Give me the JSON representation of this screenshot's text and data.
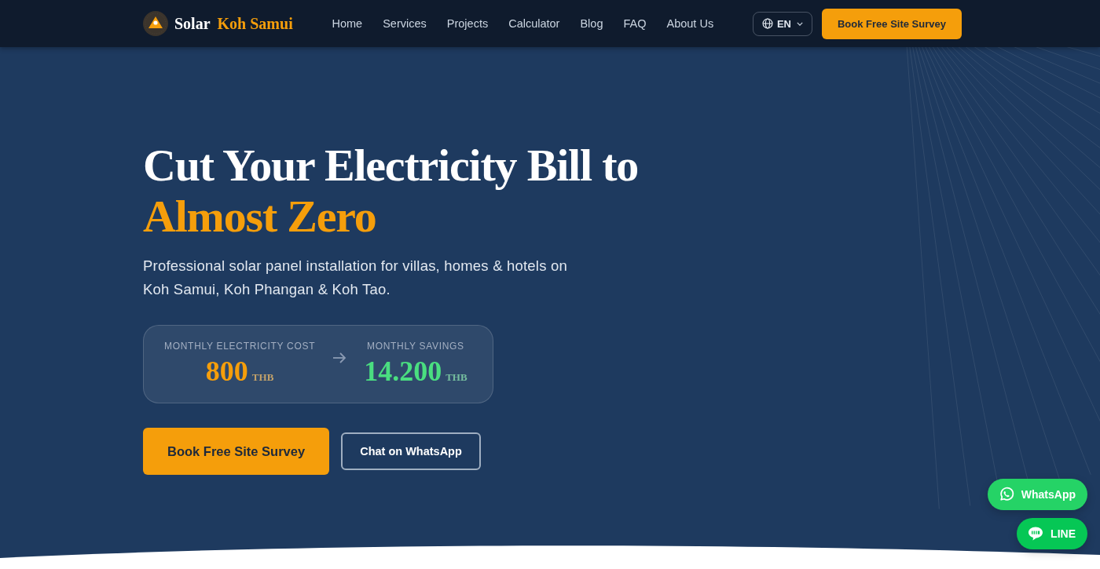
{
  "nav": {
    "brand": {
      "name": "Solar",
      "highlight": "Koh Samui"
    },
    "links": [
      "Home",
      "Services",
      "Projects",
      "Calculator",
      "Blog",
      "FAQ",
      "About Us"
    ],
    "language": "EN",
    "cta": "Book Free Site Survey"
  },
  "hero": {
    "headline": "Cut Your Electricity Bill to",
    "headline_highlight": "Almost Zero",
    "subtitle": "Professional solar panel installation for villas, homes & hotels on Koh Samui, Koh Phangan & Koh Tao.",
    "stats": [
      {
        "label": "MONTHLY ELECTRICITY COST",
        "value": "800",
        "unit": "THB",
        "color": "#f59e0b"
      },
      {
        "label": "MONTHLY SAVINGS",
        "value": "14.200",
        "unit": "THB",
        "color": "#4ade80"
      }
    ],
    "buttons": [
      {
        "label": "Book Free Site Survey",
        "kind": "primary"
      },
      {
        "label": "Chat on WhatsApp",
        "kind": "outline"
      }
    ]
  },
  "floating_buttons": [
    {
      "label": "WhatsApp",
      "kind": "whatsapp"
    },
    {
      "label": "LINE",
      "kind": "line"
    }
  ]
}
